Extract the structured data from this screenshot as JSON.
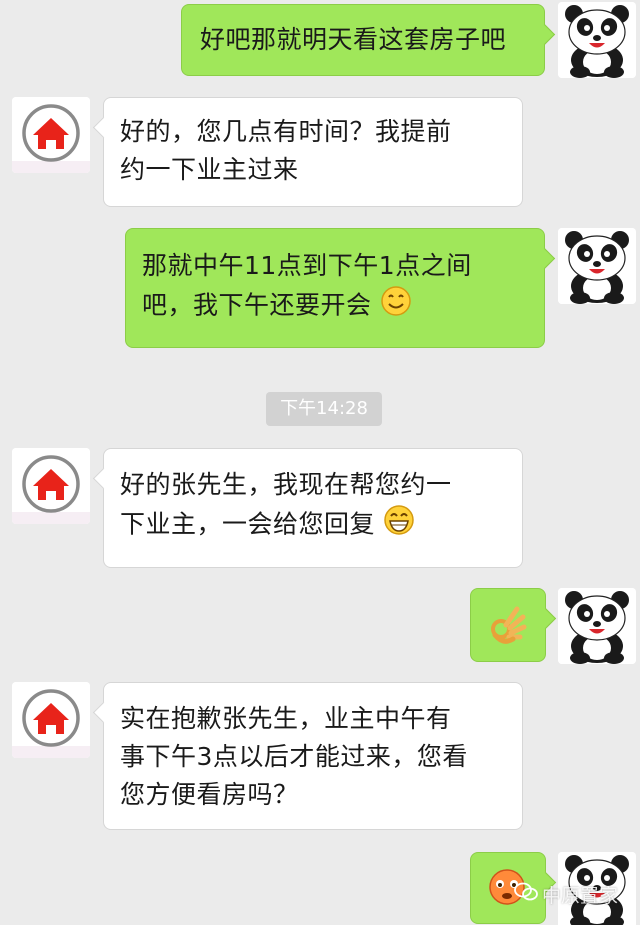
{
  "conversation": {
    "messages": [
      {
        "sender": "me",
        "text": "好吧那就明天看这套房子吧"
      },
      {
        "sender": "other",
        "line1": "好的，您几点有时间？我提前",
        "line2": "约一下业主过来"
      },
      {
        "sender": "me",
        "line1": "那就中午11点到下午1点之间",
        "line2": "吧，我下午还要开会",
        "emoji": "smile-emoji"
      },
      {
        "sender": "other",
        "line1": "好的张先生，我现在帮您约一",
        "line2": "下业主，一会给您回复",
        "emoji": "grin-emoji"
      },
      {
        "sender": "me",
        "emoji": "ok-hand-emoji"
      },
      {
        "sender": "other",
        "line1": "实在抱歉张先生，业主中午有",
        "line2": "事下午3点以后才能过来，您看",
        "line3": "您方便看房吗？"
      },
      {
        "sender": "me",
        "emoji": "worried-emoji"
      }
    ],
    "timestamp": "下午14:28"
  },
  "avatars": {
    "me": "panda-avatar",
    "other": "house-logo-avatar"
  },
  "watermark": {
    "text": "中原置家",
    "icon": "wechat-icon"
  },
  "colors": {
    "background": "#ebebeb",
    "my_bubble": "#a0e75a",
    "other_bubble": "#ffffff",
    "house_logo": "#e8231a",
    "timestamp_bg": "#d2d2d2"
  }
}
